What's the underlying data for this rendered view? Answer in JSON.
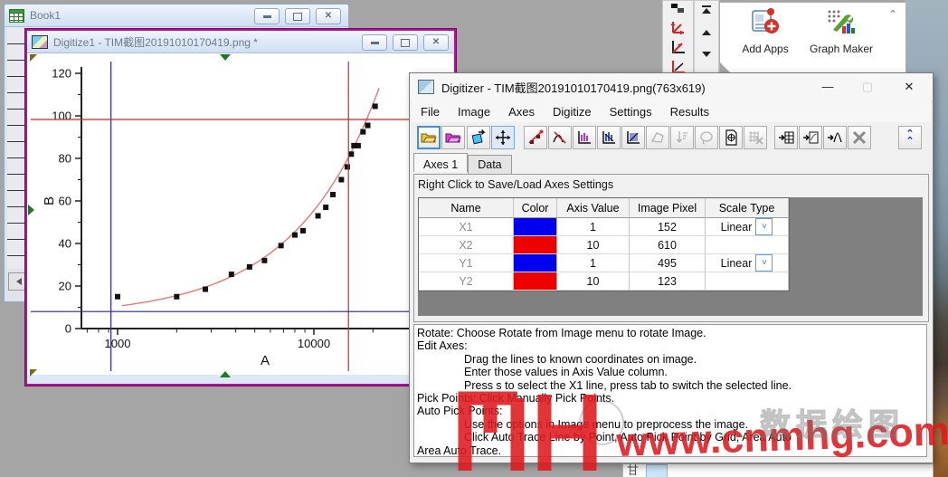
{
  "book1_window": {
    "title": "Book1"
  },
  "digitize_window": {
    "title": "Digitize1 - TIM截图20191010170419.png *"
  },
  "top_toolbar": {
    "apps": [
      {
        "label": "Add Apps"
      },
      {
        "label": "Graph Maker"
      }
    ]
  },
  "digitizer_dialog": {
    "title": "Digitizer - TIM截图20191010170419.png(763x619)",
    "menus": [
      "File",
      "Image",
      "Axes",
      "Digitize",
      "Settings",
      "Results"
    ],
    "tabs": [
      "Axes 1",
      "Data"
    ],
    "hint": "Right Click to Save/Load Axes Settings",
    "table": {
      "headers": [
        "Name",
        "Color",
        "Axis Value",
        "Image Pixel",
        "Scale Type"
      ],
      "rows": [
        {
          "name": "X1",
          "color": "#0000ee",
          "axis_value": "1",
          "image_pixel": "152",
          "scale_type": "Linear"
        },
        {
          "name": "X2",
          "color": "#ee0000",
          "axis_value": "10",
          "image_pixel": "610",
          "scale_type": ""
        },
        {
          "name": "Y1",
          "color": "#0000ee",
          "axis_value": "1",
          "image_pixel": "495",
          "scale_type": "Linear"
        },
        {
          "name": "Y2",
          "color": "#ee0000",
          "axis_value": "10",
          "image_pixel": "123",
          "scale_type": ""
        }
      ]
    },
    "instructions": [
      {
        "text": "Rotate: Choose Rotate from Image menu to rotate Image."
      },
      {
        "text": "Edit Axes:"
      },
      {
        "text": "Drag the lines to known coordinates on image."
      },
      {
        "text": "Enter those values in Axis Value column."
      },
      {
        "text": "Press s to select the X1 line, press tab to switch the selected line."
      },
      {
        "text": "Pick Points: Click Manually Pick Points."
      },
      {
        "text": "Auto Pick Points:"
      },
      {
        "text": "Use the options in Image menu to preprocess the image."
      },
      {
        "text": "Click Auto Trace Line by Point, Auto Pick Point by Grid, Area Auto"
      },
      {
        "text": "Area Auto Trace."
      }
    ]
  },
  "chart_data": {
    "type": "scatter",
    "title": "",
    "xlabel": "A",
    "ylabel": "B",
    "x_scale": "log",
    "xlim": [
      650,
      30000
    ],
    "ylim": [
      0,
      125
    ],
    "x_ticks": [
      1000,
      10000
    ],
    "x_minor_ticks": [
      700,
      800,
      900,
      2000,
      3000,
      4000,
      5000,
      6000,
      7000,
      8000,
      9000,
      20000
    ],
    "y_ticks": [
      0,
      20,
      40,
      60,
      80,
      100,
      120
    ],
    "points": [
      [
        1000,
        15
      ],
      [
        2000,
        15
      ],
      [
        2800,
        18.5
      ],
      [
        3800,
        25.5
      ],
      [
        4700,
        29
      ],
      [
        5600,
        32
      ],
      [
        6800,
        39
      ],
      [
        8000,
        44
      ],
      [
        8800,
        46
      ],
      [
        10500,
        53
      ],
      [
        11500,
        57
      ],
      [
        12500,
        63
      ],
      [
        13800,
        70
      ],
      [
        14800,
        76
      ],
      [
        15500,
        82
      ],
      [
        16000,
        86
      ],
      [
        16800,
        86
      ],
      [
        17800,
        92.5
      ],
      [
        18800,
        95.5
      ],
      [
        20500,
        104.5
      ]
    ],
    "marker_color": "#111111",
    "fit": {
      "intercept": 5.5,
      "slope": 0.005,
      "x_range": [
        1050,
        21500
      ],
      "color": "#e87878"
    },
    "overlay_lines": [
      {
        "name": "x1-axis-line",
        "orient": "v",
        "value": 925,
        "color": "#2222aa"
      },
      {
        "name": "x2-axis-line",
        "orient": "v",
        "value": 15000,
        "color": "#dd2222"
      },
      {
        "name": "y1-axis-line",
        "orient": "h",
        "value": 8,
        "color": "#2222aa"
      },
      {
        "name": "y2-axis-line",
        "orient": "h",
        "value": 98.3,
        "color": "#dd2222"
      }
    ]
  },
  "watermark": {
    "url": "www.cnmhg.com",
    "cn_text": "数据绘图",
    "color": "#e0191e"
  },
  "partial_window": {
    "char": "甘"
  }
}
